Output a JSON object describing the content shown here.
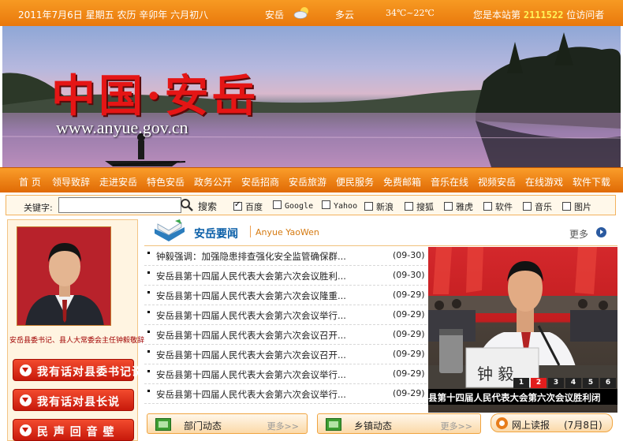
{
  "topbar": {
    "date": "2011年7月6日 星期五 农历 辛卯年 六月初八",
    "city": "安岳",
    "weather": "多云",
    "temperature": "34℃~22℃",
    "visitor_prefix": "您是本站第",
    "visitor_count": "2111522",
    "visitor_suffix": "位访问者"
  },
  "banner": {
    "title": "中国·安岳",
    "url": "www.anyue.gov.cn"
  },
  "nav": {
    "items": [
      "首 页",
      "领导致辞",
      "走进安岳",
      "特色安岳",
      "政务公开",
      "安岳招商",
      "安岳旅游",
      "便民服务",
      "免费邮箱",
      "音乐在线",
      "视频安岳",
      "在线游戏",
      "软件下载"
    ]
  },
  "search": {
    "label": "关键字:",
    "value": "",
    "button": "搜索",
    "options": [
      {
        "label": "百度",
        "checked": true
      },
      {
        "label": "Google",
        "checked": false
      },
      {
        "label": "Yahoo",
        "checked": false
      },
      {
        "label": "新浪",
        "checked": false
      },
      {
        "label": "搜狐",
        "checked": false
      },
      {
        "label": "雅虎",
        "checked": false
      },
      {
        "label": "软件",
        "checked": false
      },
      {
        "label": "音乐",
        "checked": false
      },
      {
        "label": "图片",
        "checked": false
      }
    ]
  },
  "left": {
    "caption": "安岳县委书记、县人大常委会主任钟毅敬辞",
    "buttons": [
      "我有话对县委书记说",
      "我有话对县长说",
      "民 声 回 音 壁"
    ]
  },
  "news": {
    "title": "安岳要闻",
    "subtitle": "Anyue YaoWen",
    "more": "更多",
    "items": [
      {
        "title": "钟毅强调：加强隐患排查强化安全监管确保群...",
        "date": "(09-30)"
      },
      {
        "title": "安岳县第十四届人民代表大会第六次会议胜利...",
        "date": "(09-30)"
      },
      {
        "title": "安岳县第十四届人民代表大会第六次会议隆重...",
        "date": "(09-29)"
      },
      {
        "title": "安岳县第十四届人民代表大会第六次会议举行...",
        "date": "(09-29)"
      },
      {
        "title": "安岳县第十四届人民代表大会第六次会议召开...",
        "date": "(09-29)"
      },
      {
        "title": "安岳县第十四届人民代表大会第六次会议召开...",
        "date": "(09-29)"
      },
      {
        "title": "安岳县第十四届人民代表大会第六次会议举行...",
        "date": "(09-29)"
      },
      {
        "title": "安岳县第十四届人民代表大会第六次会议举行...",
        "date": "(09-29)"
      }
    ]
  },
  "photo": {
    "caption": "县第十四届人民代表大会第六次会议胜利闭",
    "nameplate": "钟 毅",
    "pages": [
      "1",
      "2",
      "3",
      "4",
      "5",
      "6"
    ],
    "active_page": "2"
  },
  "bottom": {
    "tab1": "部门动态",
    "tab2": "乡镇动态",
    "more": "更多>>",
    "read_label": "网上读报",
    "read_date": "(7月8日)"
  },
  "colors": {
    "orange": "#e9780c",
    "red_title": "#e51515",
    "blue_title": "#0a5fa8"
  }
}
